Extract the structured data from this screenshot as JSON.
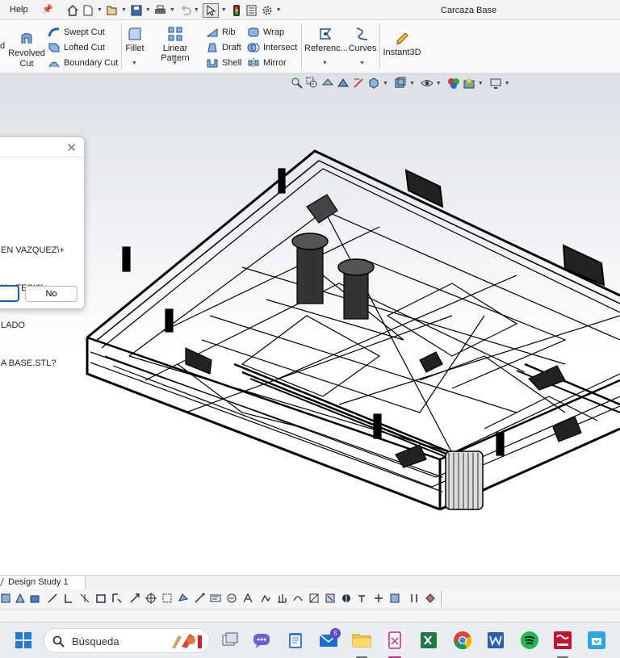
{
  "menu": {
    "help": "Help"
  },
  "document": {
    "title": "Carcaza Base"
  },
  "quick_access": [
    "home-icon",
    "new-icon",
    "open-icon",
    "save-icon",
    "print-icon",
    "undo-icon",
    "select-icon",
    "traffic-light-icon",
    "file-properties-icon",
    "options-icon"
  ],
  "ribbon": {
    "revolved_cut": [
      "Revolved",
      "Cut"
    ],
    "swept_cut": "Swept Cut",
    "lofted_cut": "Lofted Cut",
    "boundary_cut": "Boundary Cut",
    "fillet": "Fillet",
    "linear_pattern": "Linear Pattern",
    "rib": "Rib",
    "draft": "Draft",
    "shell": "Shell",
    "wrap": "Wrap",
    "intersect": "Intersect",
    "mirror": "Mirror",
    "reference_geometry": "Referenc...",
    "curves": "Curves",
    "instant3d": "Instant3D",
    "accent": "#1a5fb4"
  },
  "dialog": {
    "message_lines": [
      "EN VAZQUEZ\\+",
      "L\\+ TESIS\\+",
      "LADO",
      "A BASE.STL?"
    ],
    "no_button": "No"
  },
  "tabs": {
    "design_study": "Design Study 1"
  },
  "taskbar": {
    "search_placeholder": "Búsqueda",
    "mail_badge": "5",
    "apps": [
      "windows-start-icon",
      "search-icon",
      "task-view-icon",
      "chat-icon",
      "notepad-icon",
      "mail-icon",
      "file-explorer-icon",
      "snipping-tool-icon",
      "excel-icon",
      "chrome-icon",
      "word-icon",
      "spotify-icon",
      "solidworks-icon",
      "app-icon"
    ]
  }
}
